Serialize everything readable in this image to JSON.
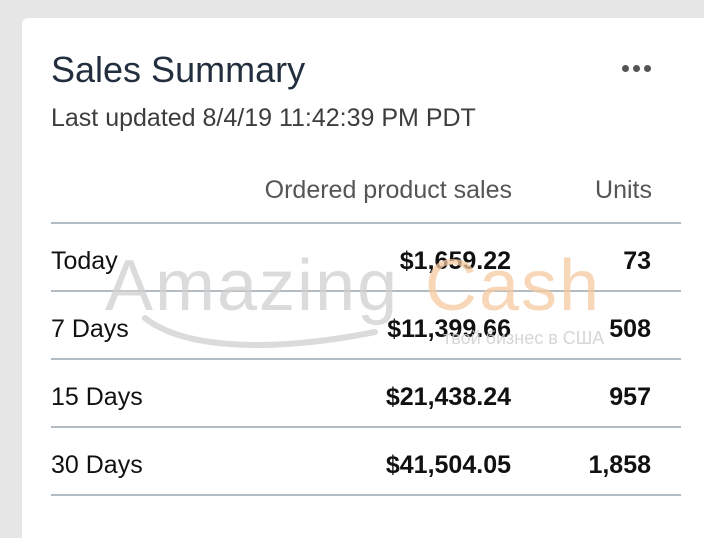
{
  "card": {
    "title": "Sales Summary",
    "last_updated": "Last updated 8/4/19 11:42:39 PM PDT",
    "menu_icon": "more-horizontal-icon"
  },
  "table": {
    "headers": {
      "sales": "Ordered product sales",
      "units": "Units"
    },
    "rows": [
      {
        "period": "Today",
        "sales": "$1,659.22",
        "units": "73"
      },
      {
        "period": "7 Days",
        "sales": "$11,399.66",
        "units": "508"
      },
      {
        "period": "15 Days",
        "sales": "$21,438.24",
        "units": "957"
      },
      {
        "period": "30 Days",
        "sales": "$41,504.05",
        "units": "1,858"
      }
    ]
  },
  "watermark": {
    "brand_part1": "Amazing",
    "brand_part2": "Cash",
    "tagline": "твой бизнес в США",
    "colors": {
      "gray": "#cfcfcf",
      "orange": "#f6c9a0"
    }
  },
  "colors": {
    "page_background": "#e6e6e6",
    "card_background": "#ffffff",
    "title": "#232f3e",
    "rule": "#b3bcc3"
  }
}
